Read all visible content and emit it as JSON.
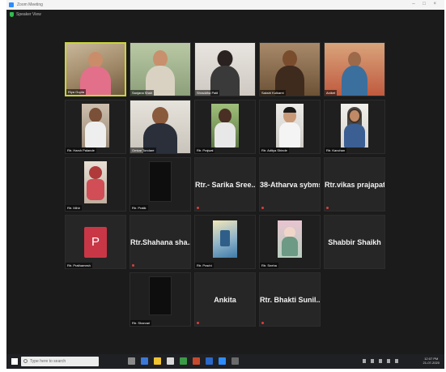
{
  "window": {
    "title": "Zoom Meeting",
    "controls": "– □ ×"
  },
  "view": {
    "label": "Speaker View"
  },
  "participants": {
    "p1": {
      "name": "Riya Gupta"
    },
    "p2": {
      "name": "Sanjana Shah"
    },
    "p3": {
      "name": "Shraddha Patil"
    },
    "p4": {
      "name": "Sakshi Kulkarni"
    },
    "p5": {
      "name": "Aniket"
    },
    "p6": {
      "name": "Rtr. Harsh Palande"
    },
    "p7": {
      "name": "Omkar Tondare"
    },
    "p8": {
      "name": "Rtr. Prajwal"
    },
    "p9": {
      "name": "Rtr. Aditya Shinde"
    },
    "p10": {
      "name": "Rtr. Kanchan"
    },
    "p11": {
      "name": "Rtr. Mihir"
    },
    "p12": {
      "name": "Rtr. Pratik"
    },
    "p13": {
      "name": "Rtr.- Sarika Sree..."
    },
    "p14": {
      "name": "38-Atharva sybms"
    },
    "p15": {
      "name": "Rtr.vikas prajapati"
    },
    "p16": {
      "name": "Rtr. Prathamesh",
      "initial": "P"
    },
    "p17": {
      "name": "Rtr.Shahana sha..."
    },
    "p18": {
      "name": "Rtr. Prachi"
    },
    "p19": {
      "name": "Rtr. Sneha"
    },
    "p20": {
      "name": "Shabbir Shaikh"
    },
    "p21": {
      "name": "Rtr. Sharvari"
    },
    "p22": {
      "name": "Ankita"
    },
    "p23": {
      "name": "Rtr. Bhakti Sunil..."
    }
  },
  "taskbar": {
    "search_placeholder": "Type here to search",
    "time": "12:07 PM",
    "date": "21-07-2020"
  }
}
